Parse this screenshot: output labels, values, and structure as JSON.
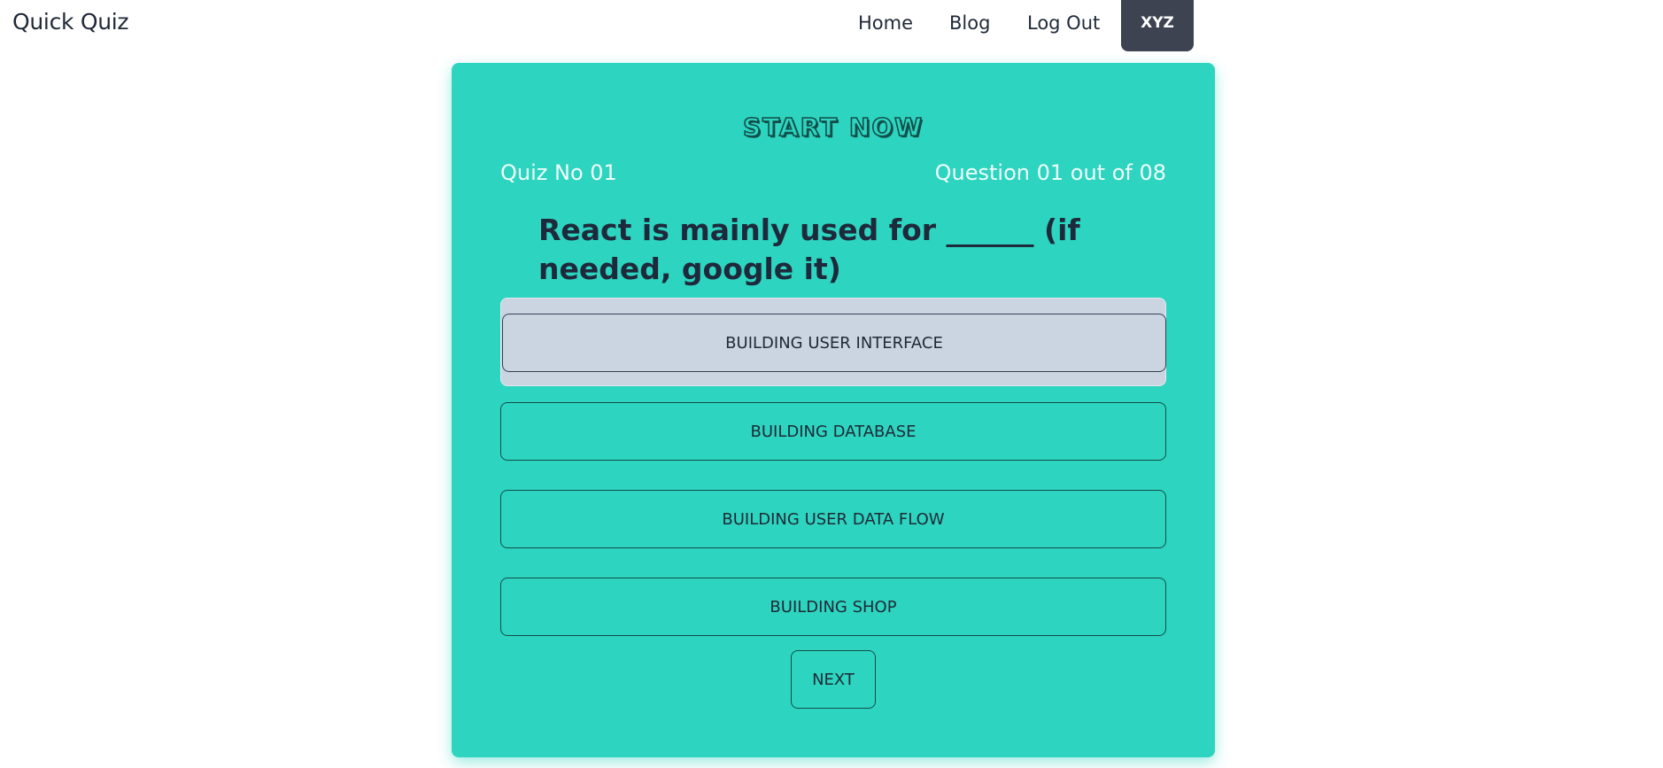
{
  "navbar": {
    "brand": "Quick Quiz",
    "links": [
      "Home",
      "Blog",
      "Log Out"
    ],
    "user_button": "XYZ"
  },
  "quiz": {
    "banner": "START NOW",
    "quiz_number": "Quiz No 01",
    "question_progress": "Question 01 out of 08",
    "question": "React is mainly used for ______ (if needed, google it)",
    "options": [
      "BUILDING USER INTERFACE",
      "BUILDING DATABASE",
      "BUILDING USER DATA FLOW",
      "BUILDING SHOP"
    ],
    "selected_index": 0,
    "next_label": "NEXT"
  },
  "colors": {
    "card_background": "#2dd4bf",
    "selected_option": "#cbd5e1",
    "user_button": "#3d4351"
  }
}
